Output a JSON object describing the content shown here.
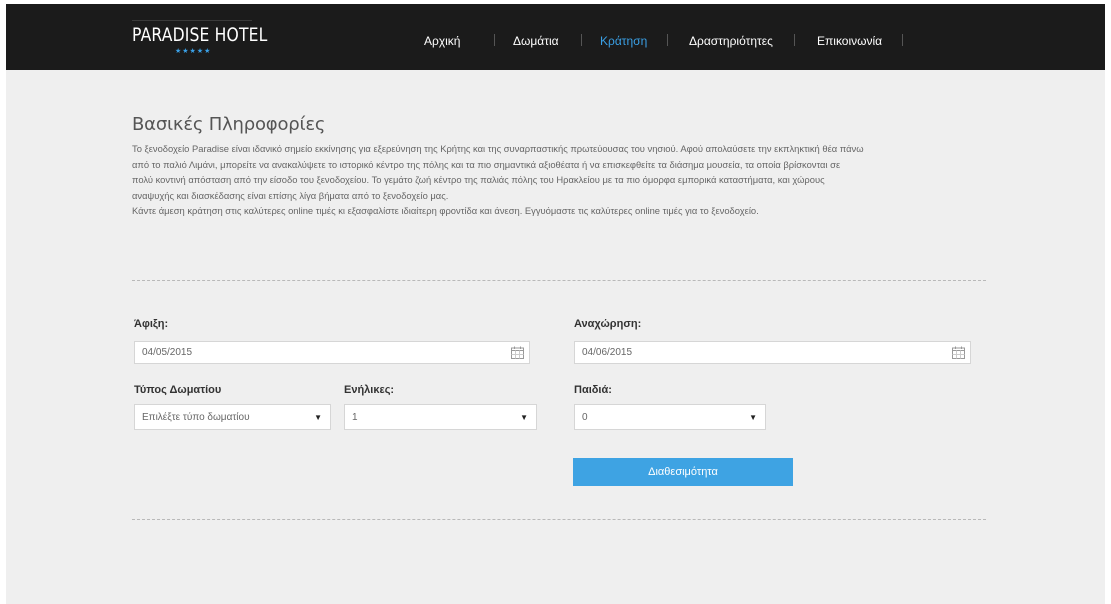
{
  "brand": {
    "name": "PARADISE HOTEL",
    "stars": "★★★★★",
    "stars_color": "#3aa0e6"
  },
  "nav": {
    "items": [
      "Αρχική",
      "Δωμάτια",
      "Κράτηση",
      "Δραστηριότητες",
      "Επικοινωνία"
    ],
    "active_index": 2
  },
  "section": {
    "title": "Βασικές Πληροφορίες",
    "paragraph_lines": [
      "Το ξενοδοχείο Paradise είναι ιδανικό σημείο εκκίνησης για εξερεύνηση της Κρήτης και της συναρπαστικής πρωτεύουσας του νησιού. Αφού απολαύσετε την εκπληκτική θέα πάνω",
      "από το παλιό Λιμάνι, μπορείτε να ανακαλύψετε το ιστορικό κέντρο της πόλης και τα πιο σημαντικά αξιοθέατα ή να επισκεφθείτε τα διάσημα μουσεία, τα οποία βρίσκονται σε",
      "πολύ κοντινή απόσταση από την είσοδο του ξενοδοχείου. Το γεμάτο ζωή κέντρο της παλιάς πόλης του Ηρακλείου με τα πιο όμορφα εμπορικά καταστήματα, και χώρους",
      "αναψυχής και διασκέδασης είναι επίσης λίγα βήματα από το ξενοδοχείο μας.",
      "Κάντε άμεση κράτηση στις καλύτερες online τιμές κι εξασφαλίστε ιδιαίτερη φροντίδα και άνεση. Εγγυόμαστε τις καλύτερες online τιμές για το ξενοδοχείο."
    ]
  },
  "form": {
    "arrival_label": "Άφιξη:",
    "arrival_value": "04/05/2015",
    "departure_label": "Αναχώρηση:",
    "departure_value": "04/06/2015",
    "room_type_label": "Τύπος Δωματίου",
    "room_type_value": "Επιλέξτε τύπο δωματίου",
    "adults_label": "Ενήλικες:",
    "adults_value": "1",
    "children_label": "Παιδιά:",
    "children_value": "0",
    "submit_label": "Διαθεσιμότητα",
    "accent": "#3ea3e3"
  }
}
